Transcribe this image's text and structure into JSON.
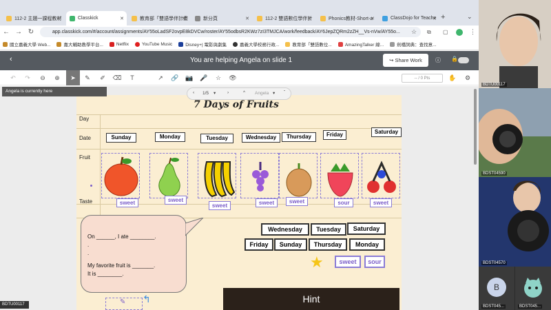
{
  "tabs": [
    {
      "label": "112-2 主題一課程教材",
      "color": "#f5c04a"
    },
    {
      "label": "Classkick",
      "color": "#3fb66d"
    },
    {
      "label": "教育部「雙語學伴計畫",
      "color": "#f5c04a"
    },
    {
      "label": "新分頁",
      "color": "#888888"
    },
    {
      "label": "112-2 雙語數位學伴計",
      "color": "#f5c04a"
    },
    {
      "label": "Phonics教材-Short-a",
      "color": "#f5c04a"
    },
    {
      "label": "ClassDojo for Teache",
      "color": "#3fa0e0"
    }
  ],
  "url": "app.classkick.com/#/account/assignments/AY55oLadSF2ovpE8kDVCw/roster/AY55odbsR2KWz7zI3TMJCA/work/feedback/AY6JepZQRm2zZH__Vs-nVw/AY55o...",
  "bookmarks": [
    "國立嘉義大學 Web...",
    "嘉大輔助教學平台...",
    "Netflix",
    "YouTube Music",
    "Disney+| 電影與劇集",
    "嘉義大學校務行政...",
    "教育部「雙語數位...",
    "AmazingTalker 線...",
    "劍橋詞典：查找意..."
  ],
  "header": {
    "title": "You are helping Angela on slide 1",
    "share": "Share Work"
  },
  "points": "-- / 0 Pts",
  "here": "Angela is currently here",
  "pager": {
    "page": "1/5",
    "student": "Angela"
  },
  "slide": {
    "title": "7 Days of Fruits",
    "row_labels": [
      "Day",
      "Date",
      "Fruit",
      "Taste"
    ],
    "days": [
      "Sunday",
      "Monday",
      "Tuesday",
      "Wednesday",
      "Thursday",
      "Friday",
      "Saturday"
    ],
    "tastes": [
      "sweet",
      "sweet",
      "sweet",
      "sweet",
      "sweet",
      "sour",
      "sweet"
    ],
    "bubble": [
      "On ______, I ate ________.",
      ".",
      ".",
      "My favorite fruit is _______.",
      "It is ________."
    ],
    "cards_row1": [
      "Wednesday",
      "Tuesday",
      "Saturday"
    ],
    "cards_row2": [
      "Friday",
      "Sunday",
      "Thursday",
      "Monday"
    ],
    "option_cards": [
      "sweet",
      "sour"
    ],
    "hint": "Hint"
  },
  "video": {
    "names": [
      "BDTU00117",
      "BDST04590",
      "BDST04570",
      "BDST045...",
      "BDST045..."
    ],
    "avatar_letter": "B"
  },
  "bottom_label": "BDTU00117",
  "colors": {
    "header": "#555a60",
    "slide": "#fbeed2",
    "accent": "#8a7bd6"
  }
}
